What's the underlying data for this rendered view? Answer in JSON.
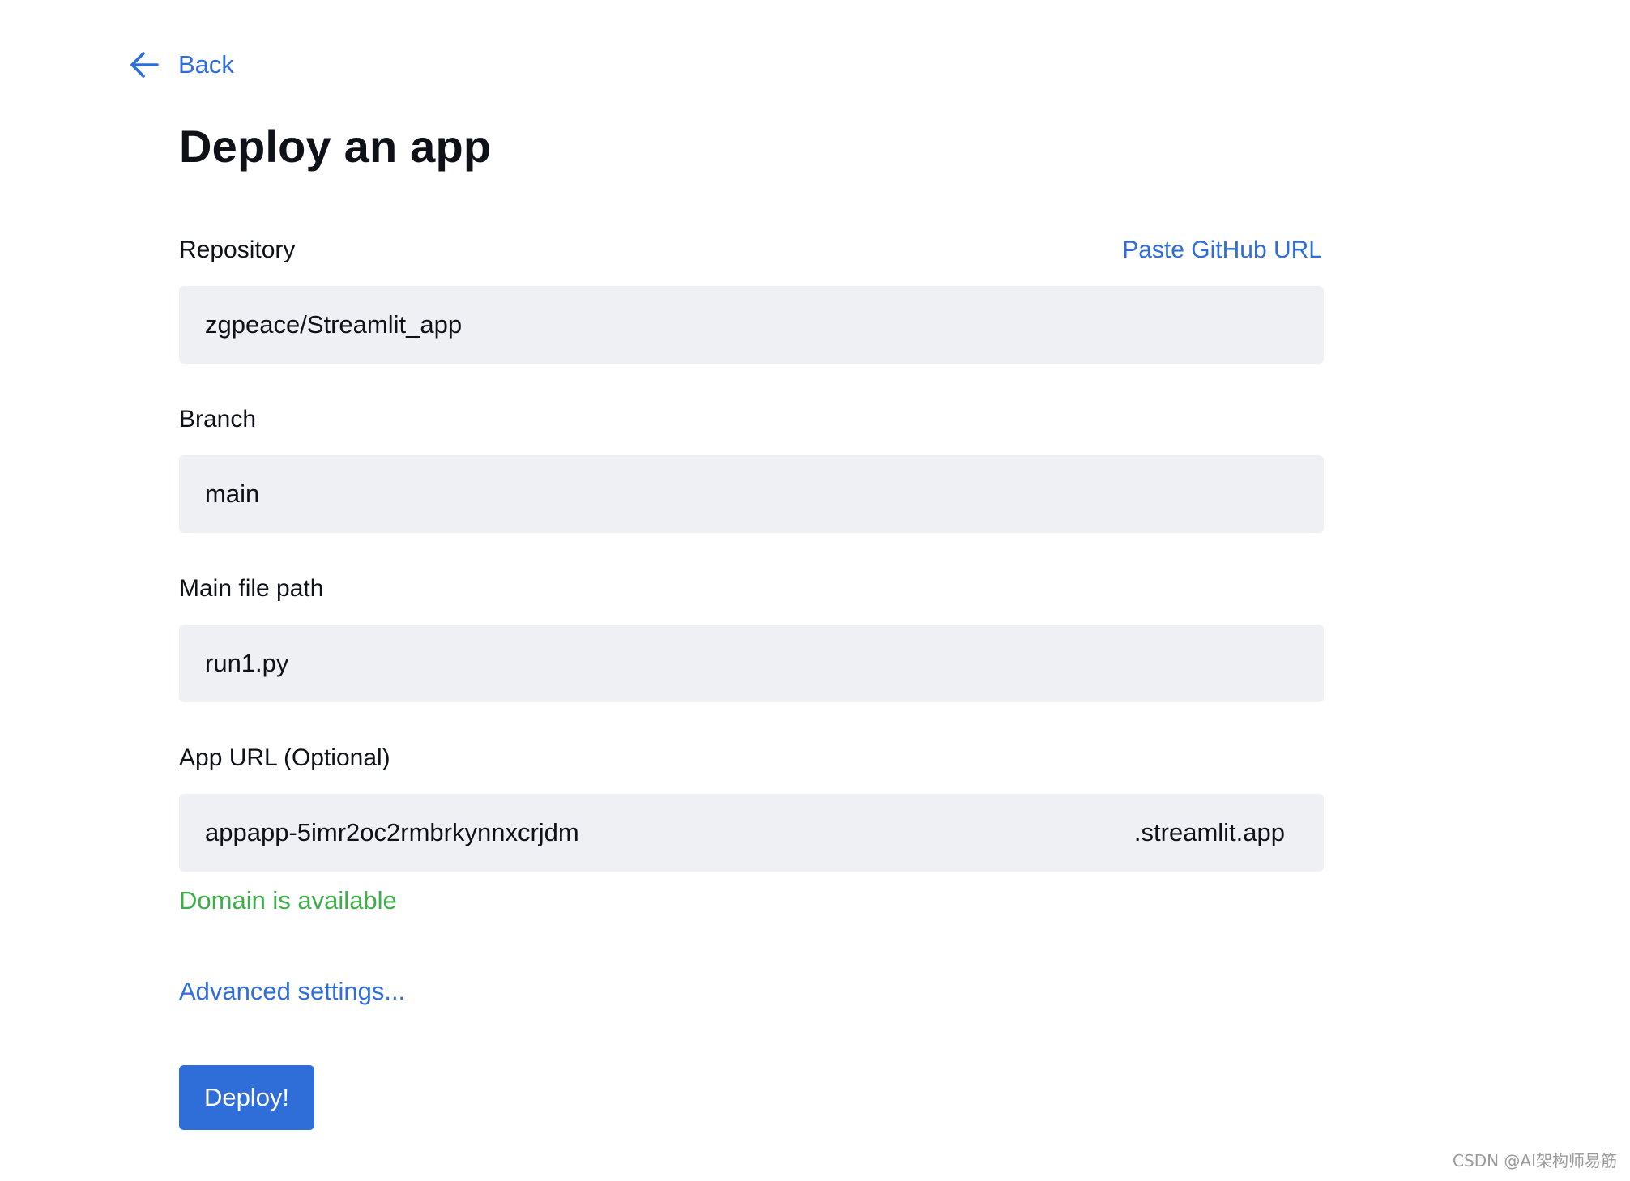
{
  "nav": {
    "back_label": "Back",
    "back_icon": "arrow-left-icon"
  },
  "page": {
    "title": "Deploy an app"
  },
  "form": {
    "repository": {
      "label": "Repository",
      "paste_link": "Paste GitHub URL",
      "value": "zgpeace/Streamlit_app"
    },
    "branch": {
      "label": "Branch",
      "value": "main"
    },
    "main_file": {
      "label": "Main file path",
      "value": "run1.py"
    },
    "app_url": {
      "label": "App URL (Optional)",
      "value": "appapp-5imr2oc2rmbrkynnxcrjdm",
      "suffix": ".streamlit.app",
      "status": "Domain is available"
    },
    "advanced_link": "Advanced settings...",
    "deploy_label": "Deploy!"
  },
  "watermark": "CSDN @AI架构师易筋",
  "colors": {
    "accent": "#2f6ed9",
    "success": "#3dae4a",
    "input_bg": "#eff0f4",
    "text": "#0e1117"
  }
}
